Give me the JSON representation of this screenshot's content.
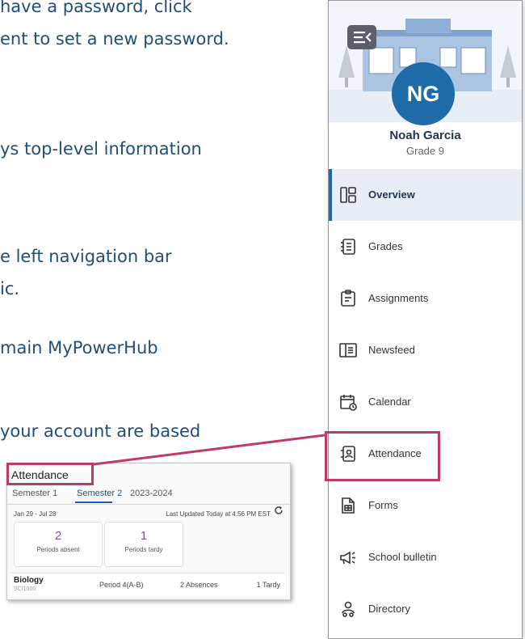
{
  "doc": {
    "line1": "have a password, click",
    "line2": "ent to set a new password.",
    "line3": "ys top-level information",
    "line4": "e left navigation bar",
    "line5": "ic.",
    "line6": "main MyPowerHub",
    "line7": "your account are based"
  },
  "attendance_card": {
    "title": "Attendance",
    "tabs": [
      {
        "label": "Semester 1",
        "active": false
      },
      {
        "label": "Semester 2",
        "active": true
      },
      {
        "label": "2023-2024",
        "active": false
      }
    ],
    "date_range": "Jan 29 - Jul 28",
    "last_updated": "Last Updated Today at 4:56 PM EST",
    "refresh_icon": "refresh-icon",
    "stats": [
      {
        "value": "2",
        "label": "Periods absent"
      },
      {
        "value": "1",
        "label": "Periods tardy"
      }
    ],
    "row": {
      "course": "Biology",
      "code": "SCI1000",
      "period": "Period 4(A-B)",
      "absences": "2 Absences",
      "tardy": "1 Tardy"
    },
    "stat_color": "#7a4fb0"
  },
  "sidebar": {
    "toggle_icon": "collapse-menu-icon",
    "avatar_initials": "NG",
    "student_name": "Noah Garcia",
    "grade": "Grade 9",
    "items": [
      {
        "label": "Overview",
        "icon": "overview-icon",
        "active": true
      },
      {
        "label": "Grades",
        "icon": "grades-icon",
        "active": false
      },
      {
        "label": "Assignments",
        "icon": "assignments-icon",
        "active": false
      },
      {
        "label": "Newsfeed",
        "icon": "newsfeed-icon",
        "active": false
      },
      {
        "label": "Calendar",
        "icon": "calendar-icon",
        "active": false
      },
      {
        "label": "Attendance",
        "icon": "attendance-icon",
        "active": false
      },
      {
        "label": "Forms",
        "icon": "forms-icon",
        "active": false
      },
      {
        "label": "School bulletin",
        "icon": "megaphone-icon",
        "active": false
      },
      {
        "label": "Directory",
        "icon": "directory-icon",
        "active": false
      }
    ]
  },
  "colors": {
    "doc_text": "#1f4e79",
    "accent": "#1e6ba8",
    "callout": "#c0396c",
    "active_bg": "#e9eef6"
  }
}
